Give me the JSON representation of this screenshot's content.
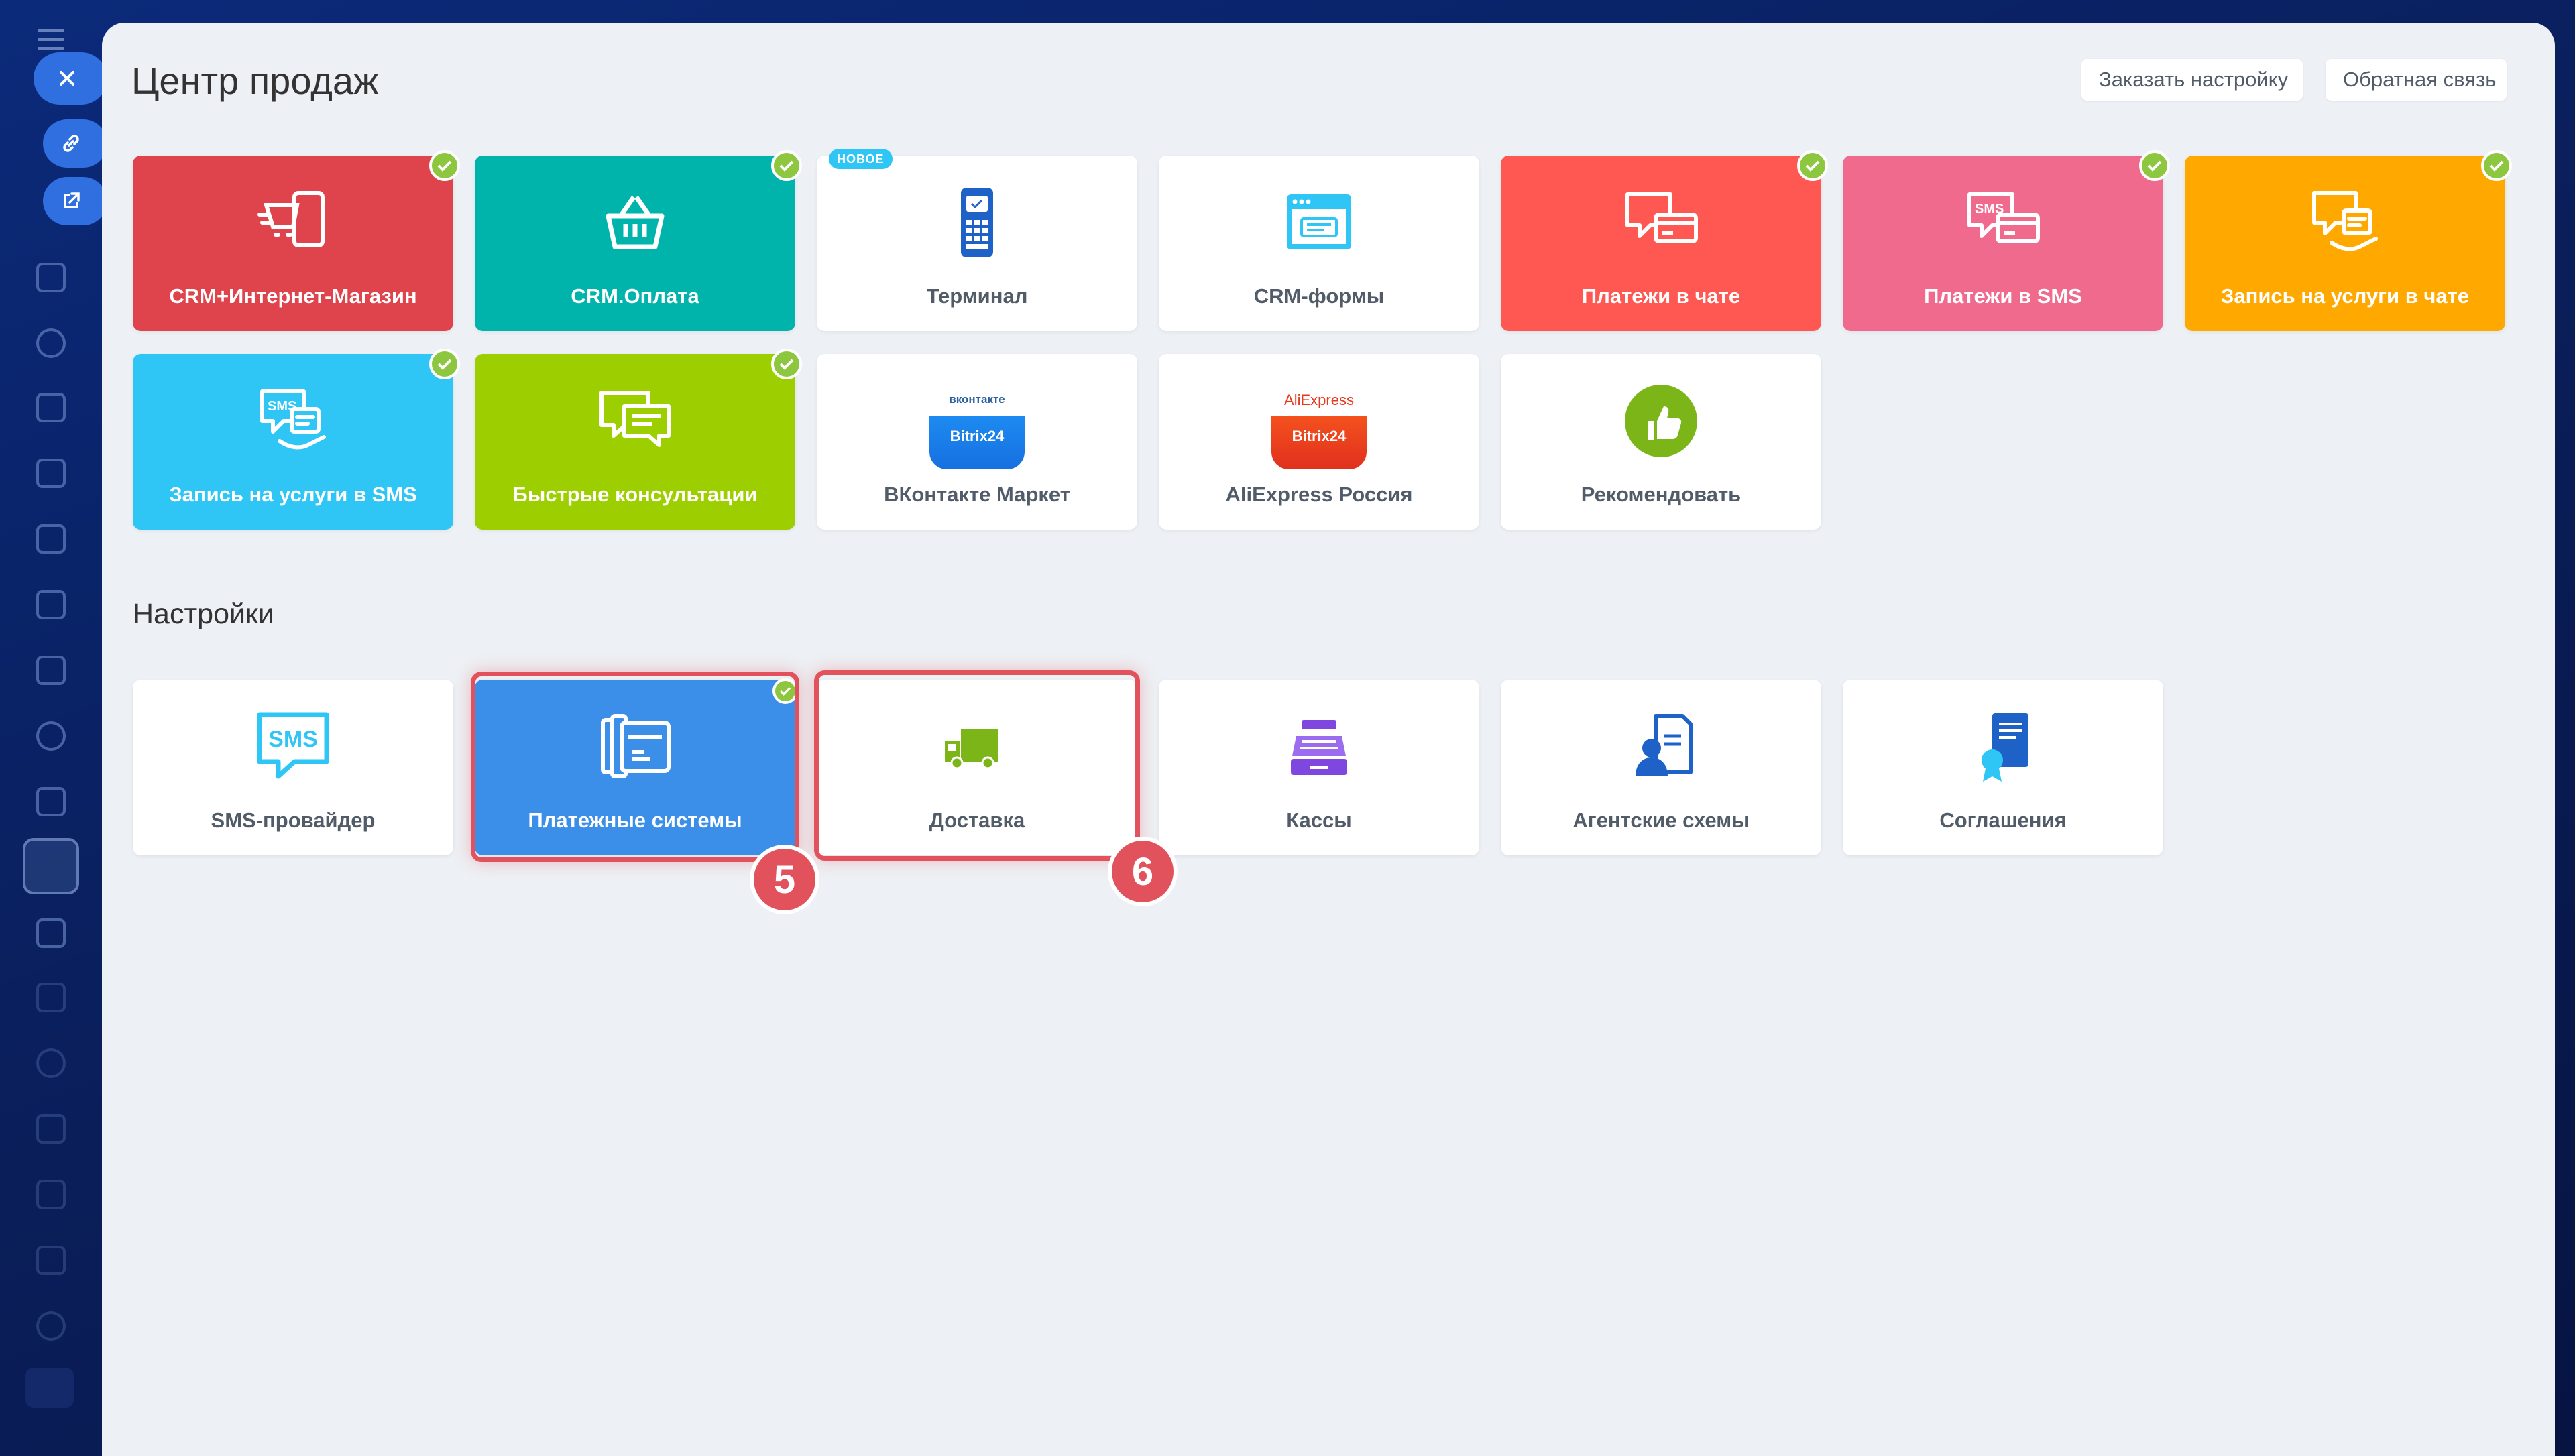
{
  "header": {
    "title": "Центр продаж",
    "order_button": "Заказать настройку",
    "feedback_button": "Обратная связь"
  },
  "tiles": [
    {
      "label": "CRM+Интернет-Магазин",
      "color": "#df434c",
      "icon": "cart-phone-icon",
      "checked": true
    },
    {
      "label": "CRM.Оплата",
      "color": "#00b4ac",
      "icon": "basket-icon",
      "checked": true
    },
    {
      "label": "Терминал",
      "color": "#ffffff",
      "icon": "terminal-icon",
      "badge": "НОВОЕ"
    },
    {
      "label": "CRM-формы",
      "color": "#ffffff",
      "icon": "crm-form-icon"
    },
    {
      "label": "Платежи в чате",
      "color": "#ff5752",
      "icon": "chat-payment-icon",
      "checked": true
    },
    {
      "label": "Платежи в SMS",
      "color": "#f06a8e",
      "icon": "sms-payment-icon",
      "checked": true
    },
    {
      "label": "Запись на услуги в чате",
      "color": "#ffa900",
      "icon": "chat-booking-icon",
      "checked": true
    },
    {
      "label": "Запись на услуги в SMS",
      "color": "#2fc6f6",
      "icon": "sms-booking-icon",
      "checked": true
    },
    {
      "label": "Быстрые консультации",
      "color": "#9dcf00",
      "icon": "consult-chat-icon",
      "checked": true
    },
    {
      "label": "ВКонтакте Маркет",
      "color": "#ffffff",
      "icon": "vk-market-icon",
      "logo_top": "вконтакте",
      "logo_bottom": "Bitrix24"
    },
    {
      "label": "AliExpress Россия",
      "color": "#ffffff",
      "icon": "aliexpress-icon",
      "logo_top": "AliExpress",
      "logo_bottom": "Bitrix24"
    },
    {
      "label": "Рекомендовать",
      "color": "#ffffff",
      "icon": "thumbs-up-icon"
    }
  ],
  "settings": {
    "title": "Настройки",
    "items": [
      {
        "label": "SMS-провайдер",
        "icon": "sms-provider-icon",
        "sms_text": "SMS"
      },
      {
        "label": "Платежные системы",
        "icon": "payment-systems-icon",
        "checked": true,
        "color": "#3b8fe8"
      },
      {
        "label": "Доставка",
        "icon": "truck-icon"
      },
      {
        "label": "Кассы",
        "icon": "cash-register-icon"
      },
      {
        "label": "Агентские схемы",
        "icon": "agent-scheme-icon"
      },
      {
        "label": "Соглашения",
        "icon": "agreement-icon"
      }
    ]
  },
  "annotations": {
    "step5": "5",
    "step6": "6",
    "highlight_color": "#e2525c"
  }
}
